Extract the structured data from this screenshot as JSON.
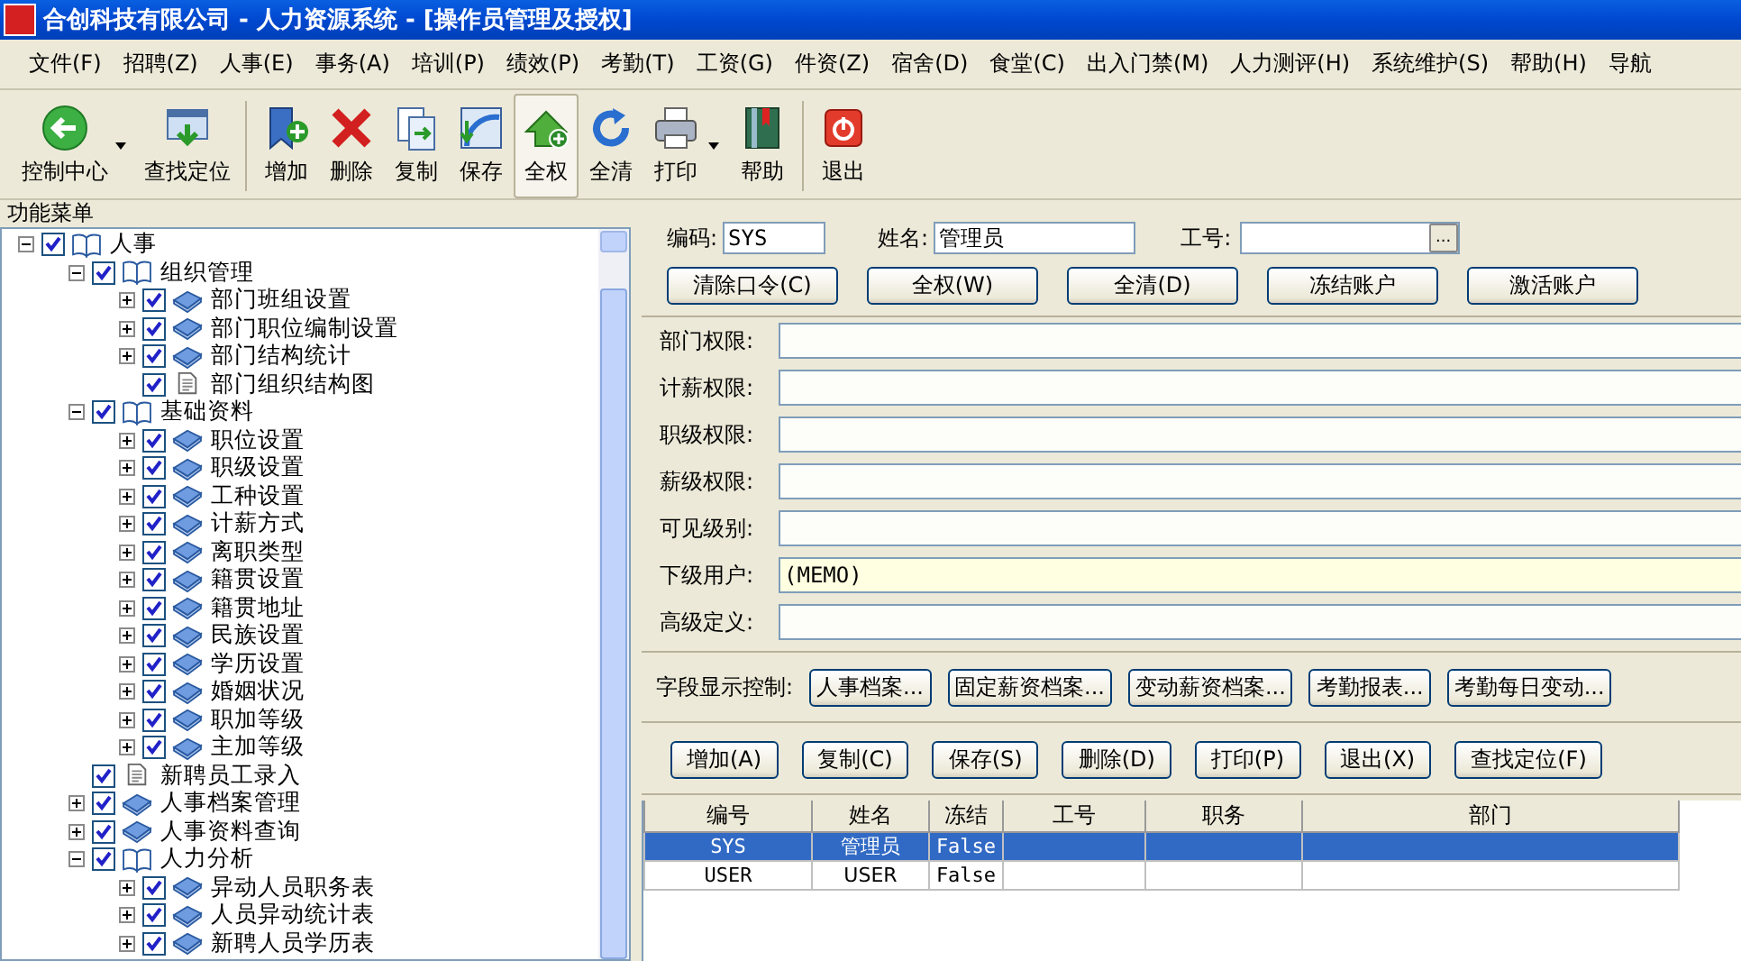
{
  "window": {
    "title": "合创科技有限公司 - 人力资源系统 - [操作员管理及授权]"
  },
  "menu": [
    "文件(F)",
    "招聘(Z)",
    "人事(E)",
    "事务(A)",
    "培训(P)",
    "绩效(P)",
    "考勤(T)",
    "工资(G)",
    "件资(Z)",
    "宿舍(D)",
    "食堂(C)",
    "出入门禁(M)",
    "人力测评(H)",
    "系统维护(S)",
    "帮助(H)",
    "导航"
  ],
  "toolbar": [
    {
      "label": "控制中心",
      "kind": "back",
      "dropdown": true,
      "pressed": false
    },
    {
      "label": "查找定位",
      "kind": "locate",
      "dropdown": false,
      "pressed": false
    },
    {
      "label": "增加",
      "kind": "add",
      "dropdown": false,
      "pressed": false
    },
    {
      "label": "删除",
      "kind": "delete",
      "dropdown": false,
      "pressed": false
    },
    {
      "label": "复制",
      "kind": "copy",
      "dropdown": false,
      "pressed": false
    },
    {
      "label": "保存",
      "kind": "save",
      "dropdown": false,
      "pressed": false
    },
    {
      "label": "全权",
      "kind": "grant",
      "dropdown": false,
      "pressed": true
    },
    {
      "label": "全清",
      "kind": "refresh",
      "dropdown": false,
      "pressed": false
    },
    {
      "label": "打印",
      "kind": "print",
      "dropdown": true,
      "pressed": false
    },
    {
      "label": "帮助",
      "kind": "help",
      "dropdown": false,
      "pressed": false
    },
    {
      "label": "退出",
      "kind": "exit",
      "dropdown": false,
      "pressed": false
    }
  ],
  "sidebar": {
    "title": "功能菜单",
    "tree": [
      {
        "label": "人事",
        "kind": "group",
        "expanded": true,
        "checked": true,
        "children": [
          {
            "label": "组织管理",
            "kind": "group",
            "expanded": true,
            "checked": true,
            "children": [
              {
                "label": "部门班组设置",
                "kind": "group",
                "expanded": false,
                "checked": true
              },
              {
                "label": "部门职位编制设置",
                "kind": "group",
                "expanded": false,
                "checked": true
              },
              {
                "label": "部门结构统计",
                "kind": "group",
                "expanded": false,
                "checked": true
              },
              {
                "label": "部门组织结构图",
                "kind": "page",
                "checked": true
              }
            ]
          },
          {
            "label": "基础资料",
            "kind": "group",
            "expanded": true,
            "checked": true,
            "children": [
              {
                "label": "职位设置",
                "kind": "group",
                "expanded": false,
                "checked": true
              },
              {
                "label": "职级设置",
                "kind": "group",
                "expanded": false,
                "checked": true
              },
              {
                "label": "工种设置",
                "kind": "group",
                "expanded": false,
                "checked": true
              },
              {
                "label": "计薪方式",
                "kind": "group",
                "expanded": false,
                "checked": true
              },
              {
                "label": "离职类型",
                "kind": "group",
                "expanded": false,
                "checked": true
              },
              {
                "label": "籍贯设置",
                "kind": "group",
                "expanded": false,
                "checked": true
              },
              {
                "label": "籍贯地址",
                "kind": "group",
                "expanded": false,
                "checked": true
              },
              {
                "label": "民族设置",
                "kind": "group",
                "expanded": false,
                "checked": true
              },
              {
                "label": "学历设置",
                "kind": "group",
                "expanded": false,
                "checked": true
              },
              {
                "label": "婚姻状况",
                "kind": "group",
                "expanded": false,
                "checked": true
              },
              {
                "label": "职加等级",
                "kind": "group",
                "expanded": false,
                "checked": true
              },
              {
                "label": "主加等级",
                "kind": "group",
                "expanded": false,
                "checked": true
              }
            ]
          },
          {
            "label": "新聘员工录入",
            "kind": "page",
            "checked": true
          },
          {
            "label": "人事档案管理",
            "kind": "group",
            "expanded": false,
            "checked": true
          },
          {
            "label": "人事资料查询",
            "kind": "group",
            "expanded": false,
            "checked": true
          },
          {
            "label": "人力分析",
            "kind": "group",
            "expanded": true,
            "checked": true,
            "children": [
              {
                "label": "异动人员职务表",
                "kind": "group",
                "expanded": false,
                "checked": true
              },
              {
                "label": "人员异动统计表",
                "kind": "group",
                "expanded": false,
                "checked": true
              },
              {
                "label": "新聘人员学历表",
                "kind": "group",
                "expanded": false,
                "checked": true
              }
            ]
          }
        ]
      }
    ]
  },
  "user": {
    "code_label": "编码:",
    "code": "SYS",
    "name_label": "姓名:",
    "name": "管理员",
    "id_label": "工号:",
    "id_button": "..."
  },
  "account_buttons": [
    "清除口令(C)",
    "全权(W)",
    "全清(D)",
    "冻结账户",
    "激活账户"
  ],
  "permissions": [
    {
      "label": "部门权限:",
      "kind": "text"
    },
    {
      "label": "计薪权限:",
      "kind": "text"
    },
    {
      "label": "职级权限:",
      "kind": "text"
    },
    {
      "label": "薪级权限:",
      "kind": "text"
    },
    {
      "label": "可见级别:",
      "kind": "text"
    },
    {
      "label": "下级用户:",
      "kind": "memo",
      "value": "(MEMO)"
    },
    {
      "label": "高级定义:",
      "kind": "text"
    }
  ],
  "field_control": {
    "label": "字段显示控制:",
    "buttons": [
      "人事档案...",
      "固定薪资档案...",
      "变动薪资档案...",
      "考勤报表...",
      "考勤每日变动..."
    ]
  },
  "action_buttons": [
    "增加(A)",
    "复制(C)",
    "保存(S)",
    "删除(D)",
    "打印(P)",
    "退出(X)",
    "查找定位(F)"
  ],
  "table": {
    "columns": [
      "编号",
      "姓名",
      "冻结",
      "工号",
      "职务",
      "部门"
    ],
    "rows": [
      {
        "cells": [
          "SYS",
          "管理员",
          "False",
          "",
          "",
          ""
        ],
        "selected": true
      },
      {
        "cells": [
          "USER",
          "USER",
          "False",
          "",
          "",
          ""
        ],
        "selected": false
      }
    ]
  }
}
